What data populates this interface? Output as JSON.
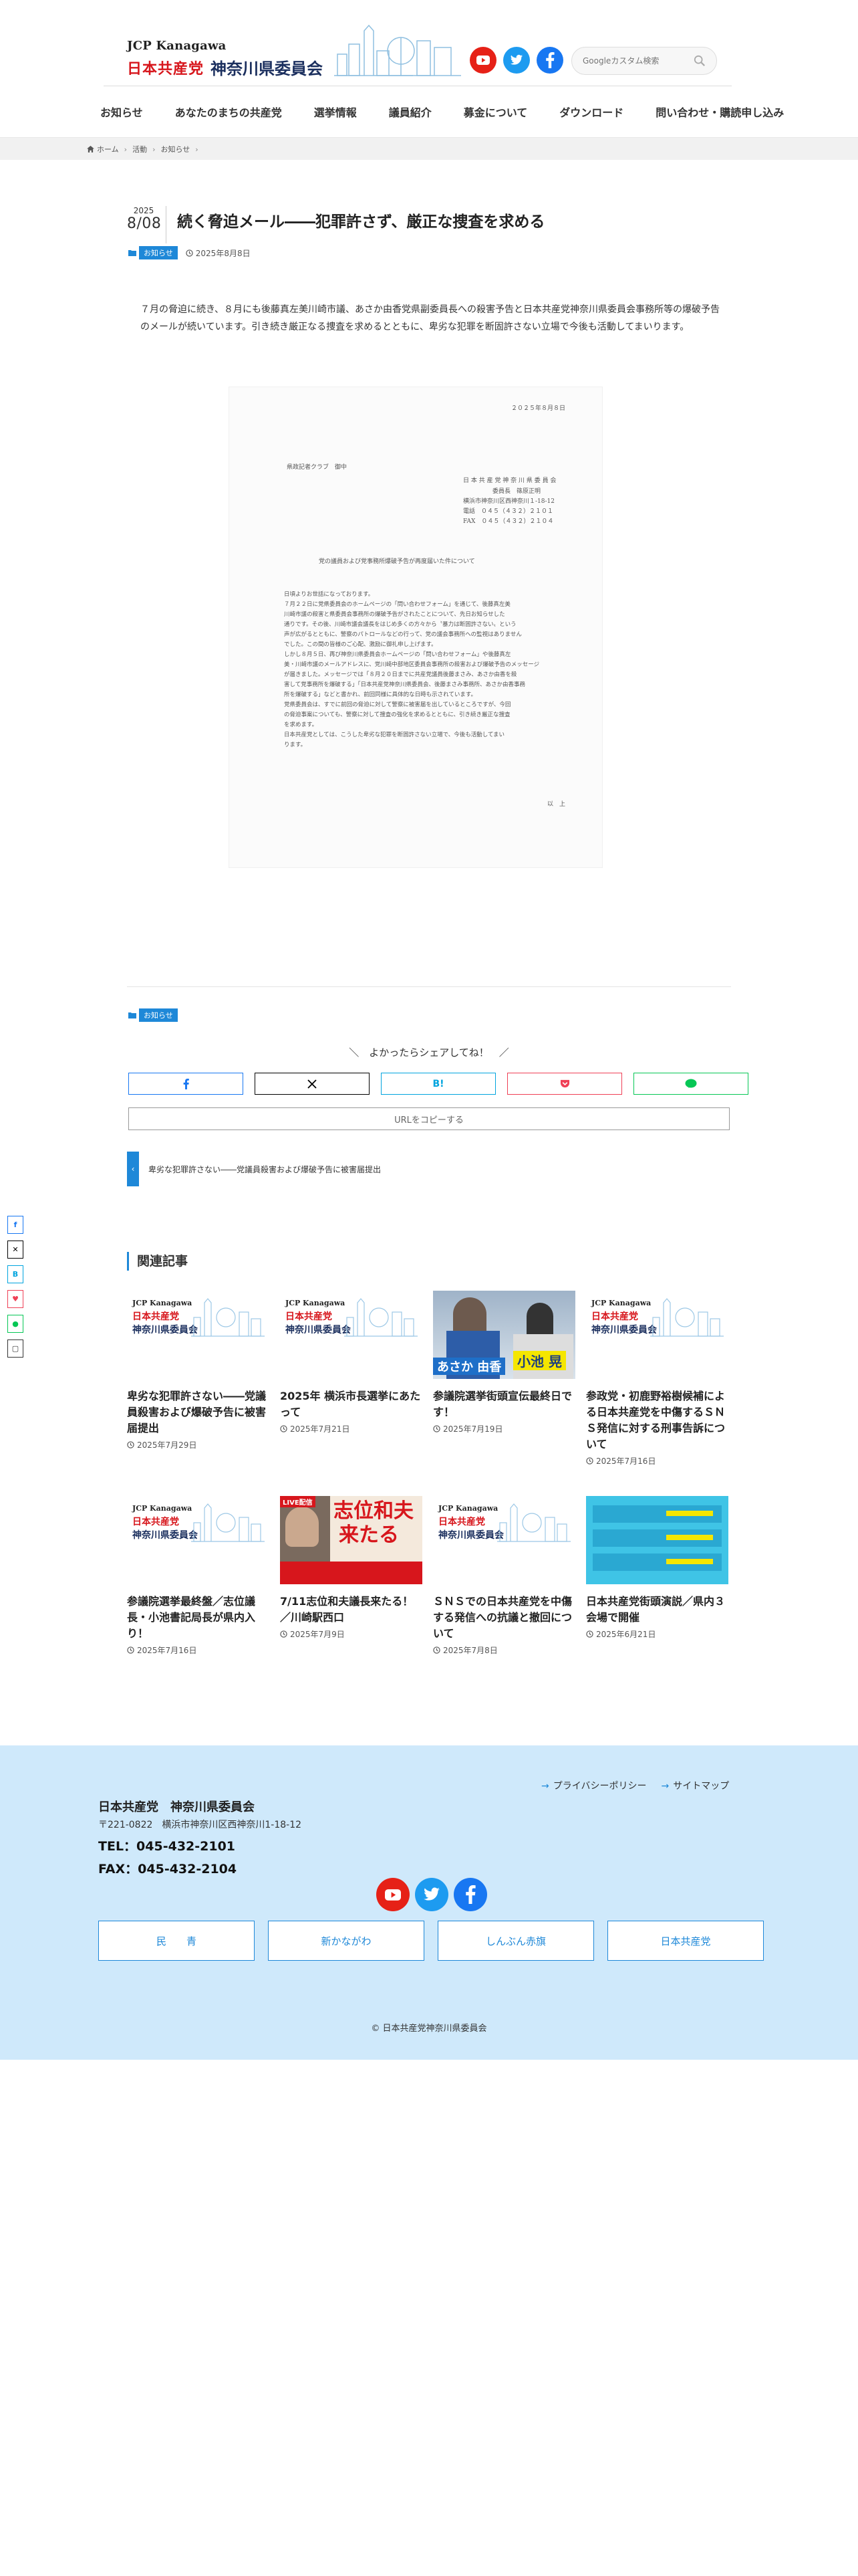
{
  "header": {
    "logo_en": "JCP Kanagawa",
    "logo_jcp": "日本共産党",
    "logo_name": "神奈川県委員会",
    "search_placeholder": "Googleカスタム検索"
  },
  "nav": [
    "お知らせ",
    "あなたのまちの共産党",
    "選挙情報",
    "議員紹介",
    "募金について",
    "ダウンロード",
    "問い合わせ・購読申し込み"
  ],
  "breadcrumb": [
    "ホーム",
    "活動",
    "お知らせ"
  ],
  "post": {
    "year": "2025",
    "month_day": "8/08",
    "title": "続く脅迫メール――犯罪許さず、厳正な捜査を求める",
    "category": "お知らせ",
    "date": "2025年8月8日",
    "lead": "７月の脅迫に続き、８月にも後藤真左美川崎市議、あさか由香党県副委員長への殺害予告と日本共産党神奈川県委員会事務所等の爆破予告のメールが続いています。引き続き厳正なる捜査を求めるとともに、卑劣な犯罪を断固許さない立場で今後も活動してまいります。"
  },
  "document": {
    "date": "２０２５年８月８日",
    "to": "県政記者クラブ　御中",
    "from1": "日 本 共 産 党 神 奈 川 県 委 員 会",
    "from2": "委員長　篠原正明",
    "from3": "横浜市神奈川区西神奈川１-18-12",
    "tel": "電話　０４５（４３２）２１０１",
    "fax": "FAX　０４５（４３２）２１０４",
    "subject": "党の議員および党事務所爆破予告が再度届いた件について",
    "body": [
      "日頃よりお世話になっております。",
      "７月２２日に党県委員会のホームページの「問い合わせフォーム」を通じて、後藤真左美",
      "川崎市議の殺害と県委員会事務所の爆破予告がされたことについて、先日お知らせした",
      "通りです。その後、川崎市議会議長をはじめ多くの方々から〝暴力は断固許さない〟という",
      "声が広がるとともに、警察のパトロールなどの行って、党の議会事務所への監視はありません",
      "でした。この間の皆様のご心配、激励に御礼申し上げます。",
      "しかし８月５日、再び神奈川県委員会ホームページの「問い合わせフォーム」や後藤真左",
      "美・川崎市議のメールアドレスに、党川崎中部地区委員会事務所の殺害および爆破予告のメッセージ",
      "が届きました。メッセージでは「８月２０日までに共産党議員後藤まさみ、あさか由香を殺",
      "害して党事務所を爆破する」「日本共産党神奈川県委員会、後藤まさみ事務所、あさか由香事務",
      "所を爆破する」などと書かれ、前回同様に具体的な日時も示されています。",
      "党県委員会は、すでに前回の脅迫に対して警察に被害届を出しているところですが、今回",
      "の脅迫事案についても、警察に対して捜査の強化を求めるとともに、引き続き厳正な捜査",
      "を求めます。",
      "日本共産党としては、こうした卑劣な犯罪を断固許さない立場で、今後も活動してまい",
      "ります。"
    ],
    "closing": "以　上"
  },
  "share": {
    "title": "＼　よかったらシェアしてね！　／",
    "copy": "URLをコピーする",
    "hatena": "B!"
  },
  "prev_post": "卑劣な犯罪許さない――党議員殺害および爆破予告に被害届提出",
  "related": {
    "heading": "関連記事",
    "thumb_en": "JCP Kanagawa",
    "thumb_jcp": "日本共産党",
    "thumb_name": "神奈川県委員会",
    "thumb3_label": "あさか 由香",
    "thumb3_label2": "小池 晃",
    "thumb6_label": "志位和夫",
    "thumb6_label2": "来たる",
    "thumb6_badge": "LIVE配信",
    "cards": [
      {
        "title": "卑劣な犯罪許さない――党議員殺害および爆破予告に被害届提出",
        "date": "2025年7月29日"
      },
      {
        "title": "2025年 横浜市長選挙にあたって",
        "date": "2025年7月21日"
      },
      {
        "title": "参議院選挙街頭宣伝最終日です！",
        "date": "2025年7月19日"
      },
      {
        "title": "参政党・初鹿野裕樹候補による日本共産党を中傷するＳＮＳ発信に対する刑事告訴について",
        "date": "2025年7月16日"
      },
      {
        "title": "参議院選挙最終盤／志位議長・小池書記局長が県内入り！",
        "date": "2025年7月16日"
      },
      {
        "title": "7/11志位和夫議長来たる！／川崎駅西口",
        "date": "2025年7月9日"
      },
      {
        "title": "ＳＮＳでの日本共産党を中傷する発信への抗議と撤回について",
        "date": "2025年7月8日"
      },
      {
        "title": "日本共産党街頭演説／県内３会場で開催",
        "date": "2025年6月21日"
      }
    ]
  },
  "footer": {
    "privacy": "プライバシーポリシー",
    "sitemap": "サイトマップ",
    "name": "日本共産党　神奈川県委員会",
    "address": "〒221-0822　横浜市神奈川区西神奈川1-18-12",
    "tel": "TEL：045-432-2101",
    "fax": "FAX：045-432-2104",
    "buttons": [
      "民　　青",
      "新かながわ",
      "しんぶん赤旗",
      "日本共産党"
    ],
    "copyright": "© 日本共産党神奈川県委員会"
  },
  "colors": {
    "accent": "#1e88d8",
    "jcp_red": "#d7161c",
    "navy": "#1b2f5e",
    "footer_bg": "#cfe9fb"
  }
}
